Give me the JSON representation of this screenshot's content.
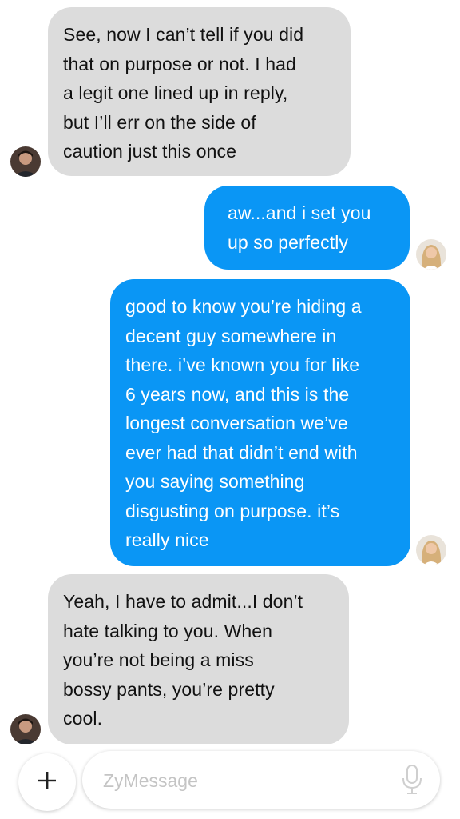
{
  "messages": [
    {
      "sender": "other",
      "text": "See, now I can’t tell if you did\nthat on purpose or not. I had\na legit one lined up in reply,\nbut I’ll err on the side of\ncaution just this once"
    },
    {
      "sender": "me",
      "text": "aw...and i set you\nup so perfectly"
    },
    {
      "sender": "me",
      "text": "good to know you’re hiding a\ndecent guy somewhere in\nthere. i’ve known you for like\n6 years now, and this is the\nlongest conversation we’ve\never had that didn’t end with\nyou saying something\ndisgusting on purpose. it’s\nreally nice"
    },
    {
      "sender": "other",
      "text": "Yeah, I have to admit...I don’t\nhate talking to you. When\nyou’re not being a miss\nbossy pants, you’re pretty\ncool."
    }
  ],
  "composer": {
    "placeholder": "ZyMessage",
    "value": ""
  },
  "colors": {
    "incoming_bubble": "#dcdcdc",
    "outgoing_bubble": "#0a96f5",
    "incoming_text": "#111111",
    "outgoing_text": "#ffffff",
    "placeholder": "#c4c4c4"
  },
  "icons": {
    "add": "plus-icon",
    "mic": "microphone-icon"
  }
}
